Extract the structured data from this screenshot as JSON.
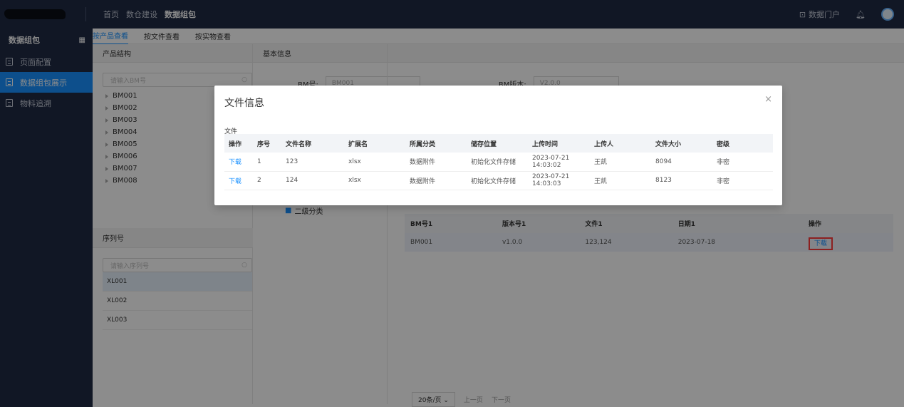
{
  "topbar": {
    "nav": [
      "首页",
      "数仓建设",
      "数据组包"
    ],
    "portal": "数据门户"
  },
  "sidebar": {
    "title": "数据组包",
    "items": [
      {
        "label": "页面配置"
      },
      {
        "label": "数据组包展示"
      },
      {
        "label": "物料追溯"
      }
    ]
  },
  "content": {
    "tabs": [
      "按产品查看",
      "按文件查看",
      "按实物查看"
    ],
    "product_panel": {
      "title": "产品结构",
      "search_placeholder": "请输入BM号",
      "tree": [
        "BM001",
        "BM002",
        "BM003",
        "BM004",
        "BM005",
        "BM006",
        "BM007",
        "BM008"
      ]
    },
    "basic_info": {
      "title": "基本信息",
      "bm_label": "BM号:",
      "bm_value": "BM001",
      "version_label": "BM版本:",
      "version_value": "V2.0.0"
    },
    "category": "二级分类",
    "serial_panel": {
      "title": "序列号",
      "search_placeholder": "请输入序列号",
      "items": [
        "XL001",
        "XL002",
        "XL003"
      ]
    },
    "result_table": {
      "headers": [
        "BM号1",
        "版本号1",
        "文件1",
        "日期1",
        "操作"
      ],
      "rows": [
        [
          "BM001",
          "v1.0.0",
          "123,124",
          "2023-07-18",
          "下载"
        ]
      ]
    },
    "pagination": {
      "page_size": "20条/页",
      "prev": "上一页",
      "next": "下一页"
    }
  },
  "modal": {
    "title": "文件信息",
    "close": "×",
    "section": "文件",
    "headers": [
      "操作",
      "序号",
      "文件名称",
      "扩展名",
      "所属分类",
      "储存位置",
      "上传时间",
      "上传人",
      "文件大小",
      "密级"
    ],
    "rows": [
      [
        "下载",
        "1",
        "123",
        "xlsx",
        "数据附件",
        "初始化文件存储",
        "2023-07-21 14:03:02",
        "王凯",
        "8094",
        "非密"
      ],
      [
        "下载",
        "2",
        "124",
        "xlsx",
        "数据附件",
        "初始化文件存储",
        "2023-07-21 14:03:03",
        "王凯",
        "8123",
        "非密"
      ]
    ]
  }
}
